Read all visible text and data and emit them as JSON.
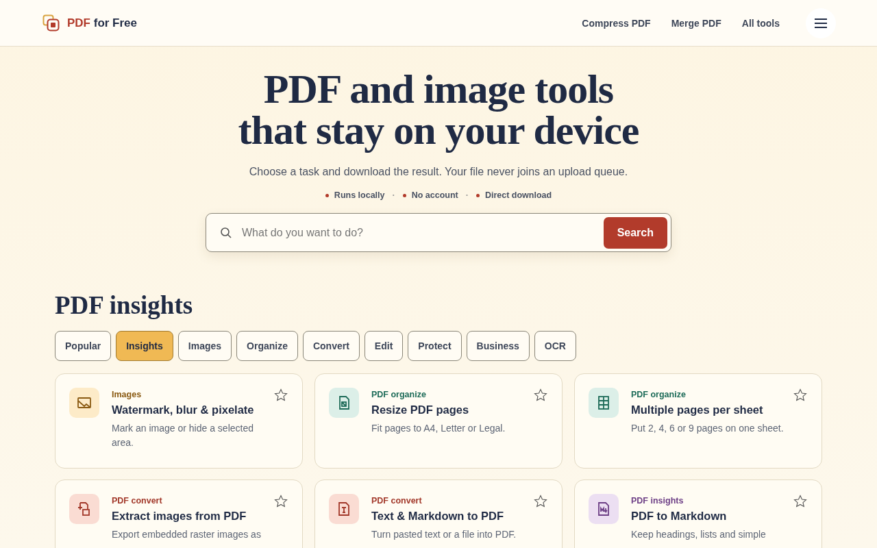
{
  "brand": {
    "accent": "PDF",
    "rest": "for Free"
  },
  "nav": [
    "Compress PDF",
    "Merge PDF",
    "All tools"
  ],
  "hero": {
    "title_lines": [
      "PDF and image tools",
      "that stay on your device"
    ],
    "subtitle": "Choose a task and download the result. Your file never joins an upload queue.",
    "features": [
      "Runs locally",
      "No account",
      "Direct download"
    ],
    "separator": "·"
  },
  "search": {
    "placeholder": "What do you want to do?",
    "button": "Search"
  },
  "section": {
    "title": "PDF insights"
  },
  "filters": [
    {
      "label": "Popular",
      "selected": false
    },
    {
      "label": "Insights",
      "selected": true
    },
    {
      "label": "Images",
      "selected": false
    },
    {
      "label": "Organize",
      "selected": false
    },
    {
      "label": "Convert",
      "selected": false
    },
    {
      "label": "Edit",
      "selected": false
    },
    {
      "label": "Protect",
      "selected": false
    },
    {
      "label": "Business",
      "selected": false
    },
    {
      "label": "OCR",
      "selected": false
    }
  ],
  "tools": [
    {
      "category": "Images",
      "color": "#8a5a12",
      "kind": "image",
      "title": "Watermark, blur & pixelate",
      "description": "Mark an image or hide a selected area.",
      "favorite": false
    },
    {
      "category": "PDF organize",
      "color": "#1d6b58",
      "kind": "resize",
      "title": "Resize PDF pages",
      "description": "Fit pages to A4, Letter or Legal.",
      "favorite": false
    },
    {
      "category": "PDF organize",
      "color": "#1d6b58",
      "kind": "grid",
      "title": "Multiple pages per sheet",
      "description": "Put 2, 4, 6 or 9 pages on one sheet.",
      "favorite": false
    },
    {
      "category": "PDF convert",
      "color": "#a2382a",
      "kind": "extract",
      "title": "Extract images from PDF",
      "description": "Export embedded raster images as",
      "favorite": false
    },
    {
      "category": "PDF convert",
      "color": "#a2382a",
      "kind": "text",
      "title": "Text & Markdown to PDF",
      "description": "Turn pasted text or a file into PDF.",
      "favorite": false
    },
    {
      "category": "PDF insights",
      "color": "#6d3f86",
      "kind": "markdown",
      "title": "PDF to Markdown",
      "description": "Keep headings, lists and simple",
      "favorite": false
    }
  ]
}
